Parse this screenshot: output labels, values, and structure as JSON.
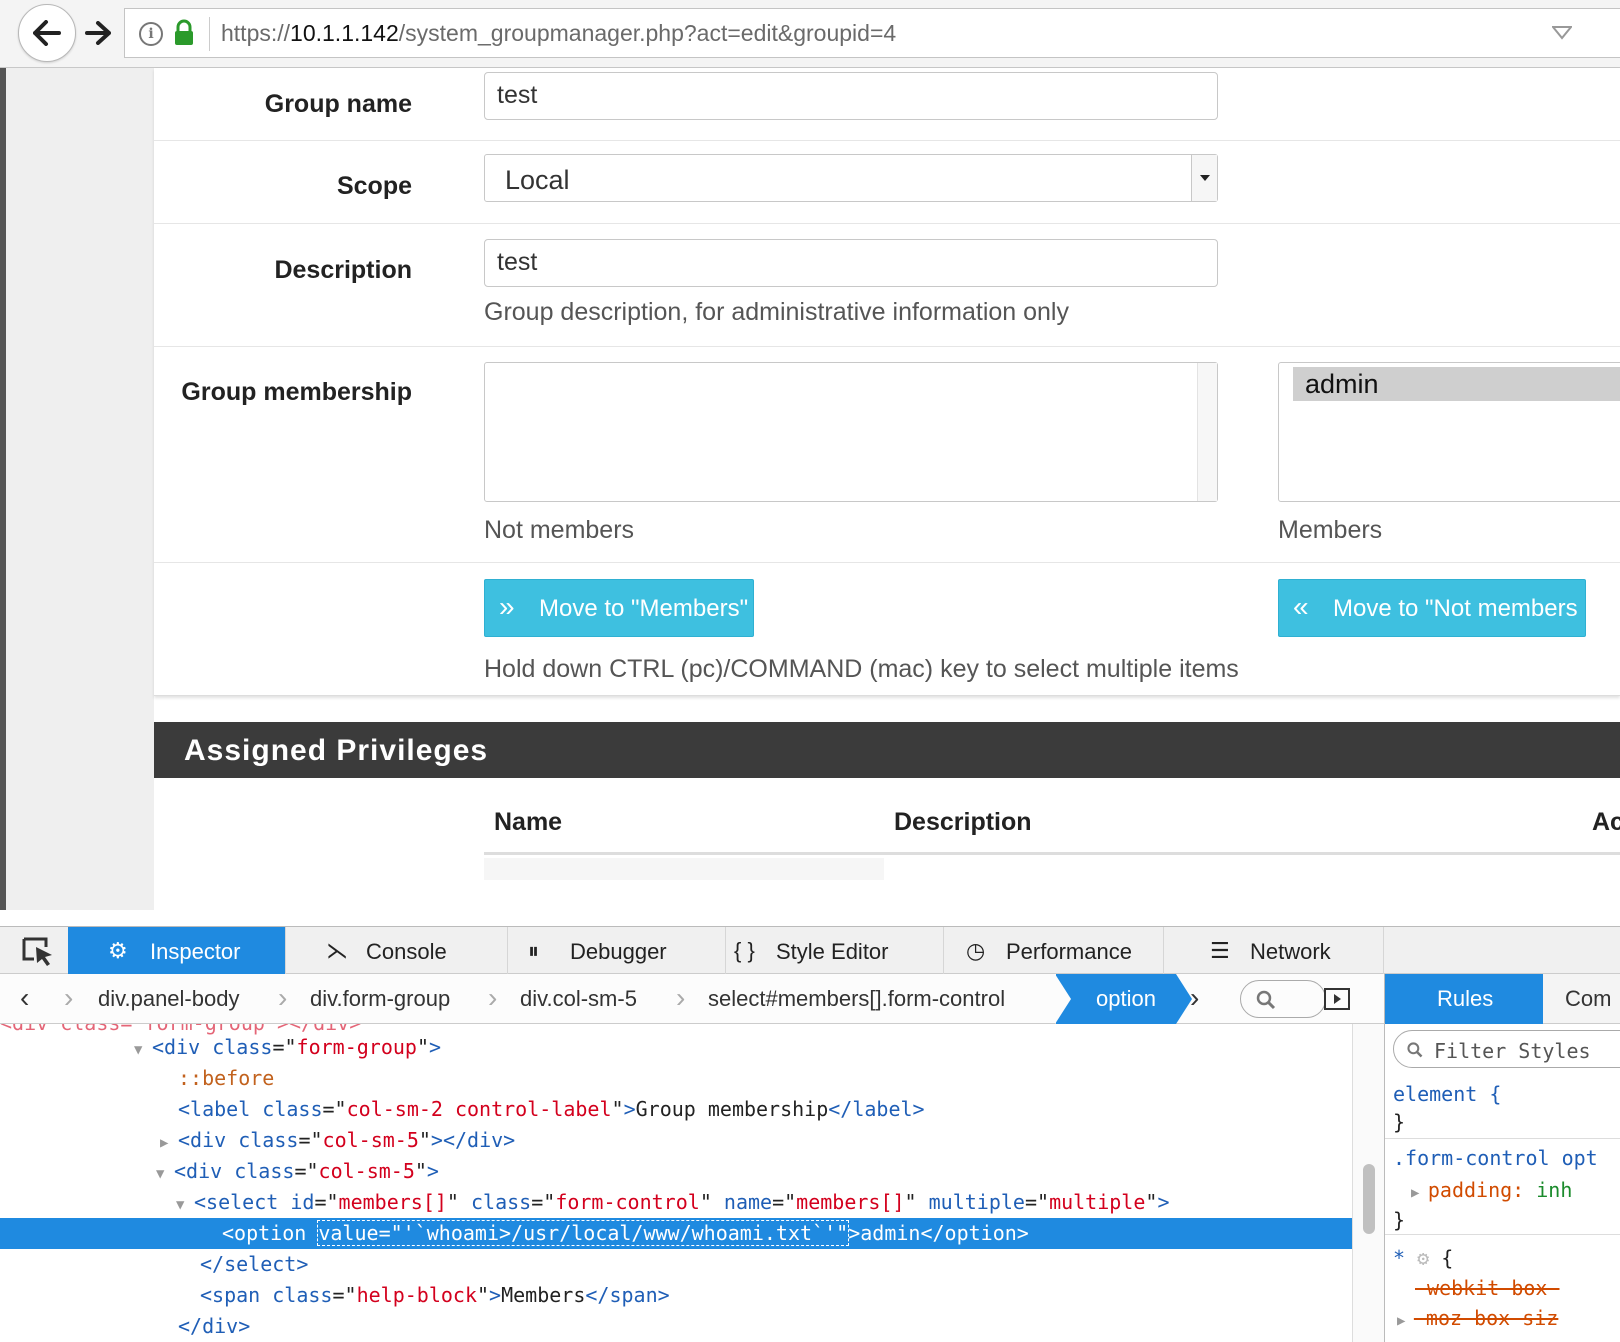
{
  "browser": {
    "url_prefix": "https://",
    "url_host": "10.1.1.142",
    "url_path": "/system_groupmanager.php?act=edit&groupid=4"
  },
  "form": {
    "group_name": {
      "label": "Group name",
      "value": "test"
    },
    "scope": {
      "label": "Scope",
      "selected": "Local"
    },
    "description": {
      "label": "Description",
      "value": "test",
      "help": "Group description, for administrative information only"
    },
    "membership": {
      "label": "Group membership",
      "not_members_help": "Not members",
      "members_help": "Members",
      "members_options": [
        "admin"
      ],
      "move_to_members_label": "Move to \"Members\"",
      "move_to_not_members_label": "Move to \"Not members",
      "multi_select_help": "Hold down CTRL (pc)/COMMAND (mac) key to select multiple items"
    }
  },
  "privileges": {
    "title": "Assigned Privileges",
    "columns": [
      "Name",
      "Description",
      "Ac"
    ]
  },
  "devtools": {
    "tabs": [
      "Inspector",
      "Console",
      "Debugger",
      "Style Editor",
      "Performance",
      "Network"
    ],
    "active_tab": "Inspector",
    "breadcrumbs": [
      "div.panel-body",
      "div.form-group",
      "div.col-sm-5",
      "select#members[].form-control",
      "option"
    ],
    "markup": {
      "partial_line": "<div class=\"form-group\"></div>",
      "form_group_open_tag": "div",
      "form_group_class": "form-group",
      "before_pseudo": "::before",
      "label_class": "col-sm-2 control-label",
      "label_text": "Group membership",
      "col_class_1": "col-sm-5",
      "col_class_2": "col-sm-5",
      "select_id": "members[]",
      "select_class": "form-control",
      "select_name": "members[]",
      "select_multiple": "multiple",
      "option_value": "'`whoami>/usr/local/www/whoami.txt`'",
      "option_text": "admin",
      "span_class": "help-block",
      "span_text": "Members"
    },
    "side_tabs": [
      "Rules",
      "Com"
    ],
    "filter_placeholder": "Filter Styles",
    "rules": {
      "element_selector": "element {",
      "close_brace": "}",
      "form_control_selector": ".form-control opt",
      "padding_prop": "padding:",
      "padding_value": "inh",
      "universal_selector": "*",
      "universal_open": "{",
      "webkit_prop": "-webkit-box-",
      "moz_prop": "-moz-box-siz"
    }
  },
  "colors": {
    "accent_blue": "#1f8ae0",
    "button_cyan": "#3ec0e0",
    "panel_header": "#3b3b3b"
  }
}
